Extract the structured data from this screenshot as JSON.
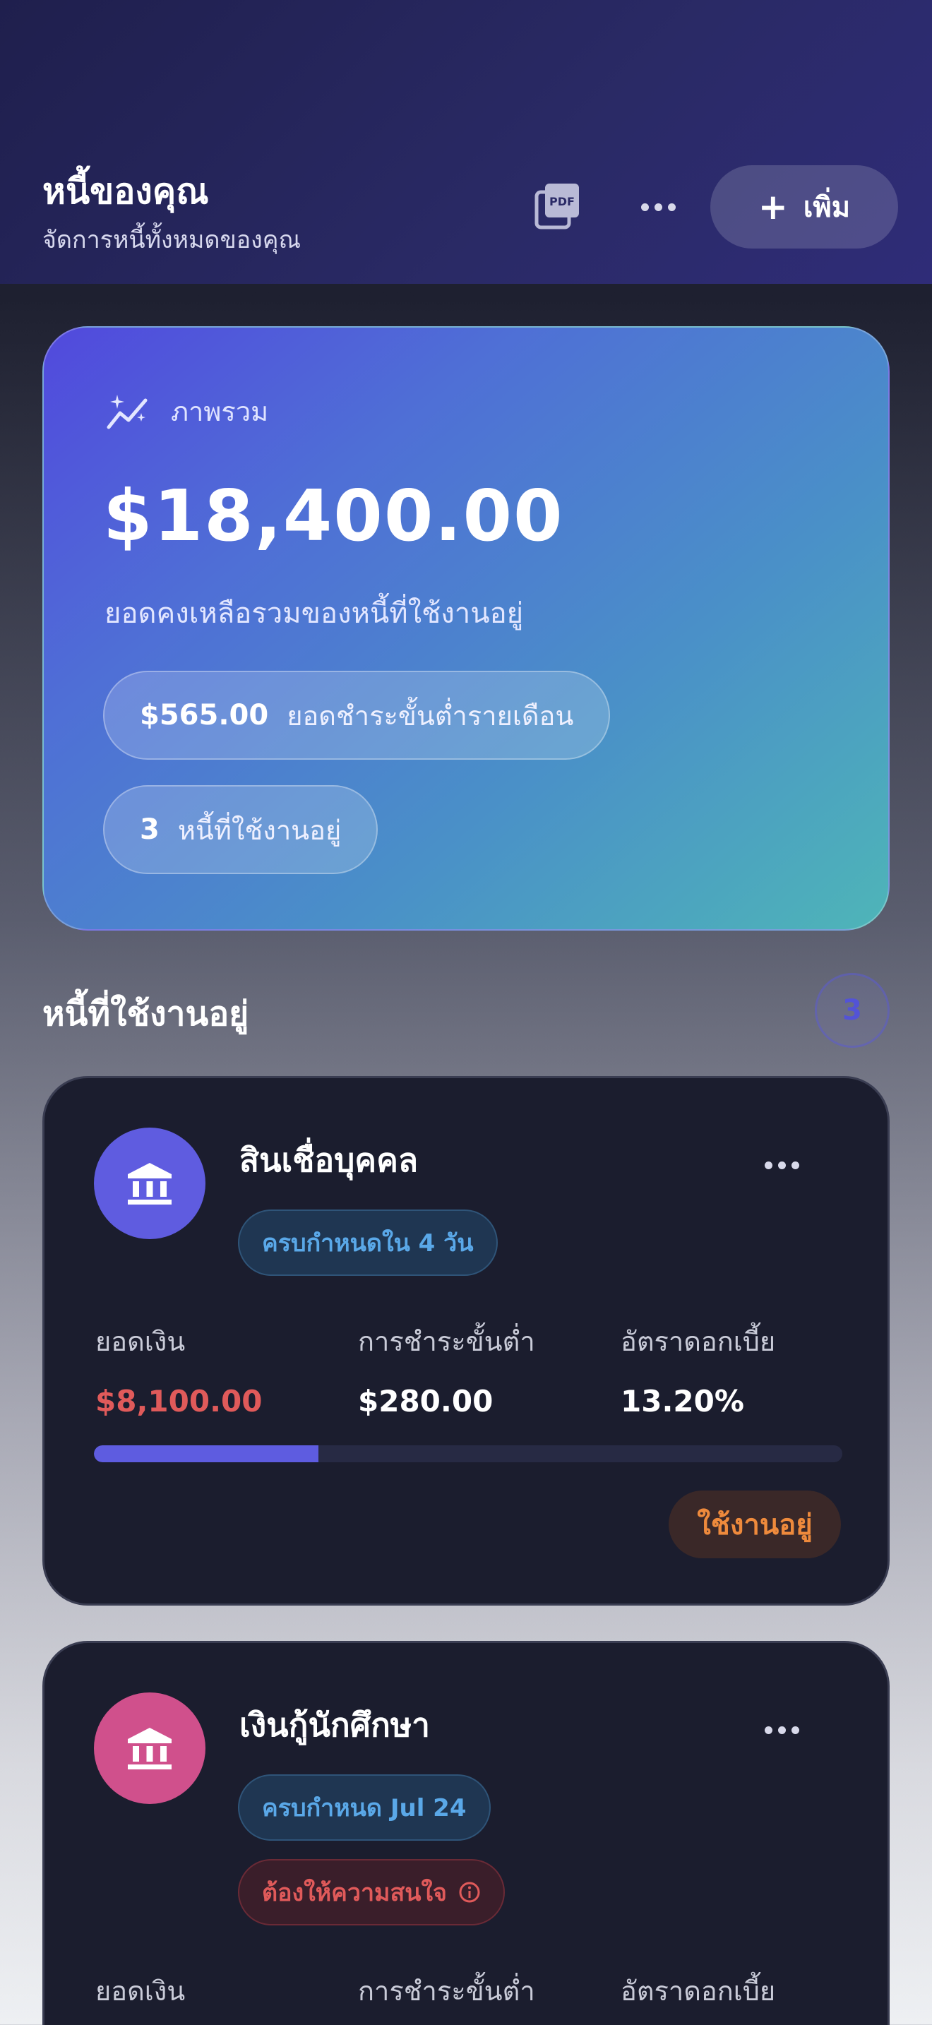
{
  "header": {
    "title": "หนี้ของคุณ",
    "subtitle": "จัดการหนี้ทั้งหมดของคุณ",
    "pdf_icon": "pdf-document-icon",
    "more_icon": "more-horizontal-icon",
    "add_label": "เพิ่ม"
  },
  "summary": {
    "label": "ภาพรวม",
    "total": "$18,400.00",
    "description": "ยอดคงเหลือรวมของหนี้ที่ใช้งานอยู่",
    "min_payment_value": "$565.00",
    "min_payment_label": "ยอดชำระขั้นต่ำรายเดือน",
    "active_count_value": "3",
    "active_count_label": "หนี้ที่ใช้งานอยู่"
  },
  "section": {
    "title": "หนี้ที่ใช้งานอยู่",
    "count": "3"
  },
  "debts": [
    {
      "name": "สินเชื่อบุคคล",
      "icon": "bank-icon",
      "icon_color": "#5f5ce0",
      "due_label": "ครบกำหนดใน 4 วัน",
      "balance_label": "ยอดเงิน",
      "balance": "$8,100.00",
      "balance_color": "#e05a5a",
      "min_label": "การชำระขั้นต่ำ",
      "min_value": "$280.00",
      "rate_label": "อัตราดอกเบี้ย",
      "rate_value": "13.20%",
      "progress": 0.3,
      "status": "ใช้งานอยู่"
    },
    {
      "name": "เงินกู้นักศึกษา",
      "icon": "bank-icon",
      "icon_color": "#d0508c",
      "due_label": "ครบกำหนด Jul 24",
      "warning_label": "ต้องให้ความสนใจ",
      "balance_label": "ยอดเงิน",
      "min_label": "การชำระขั้นต่ำ",
      "rate_label": "อัตราดอกเบี้ย"
    }
  ]
}
